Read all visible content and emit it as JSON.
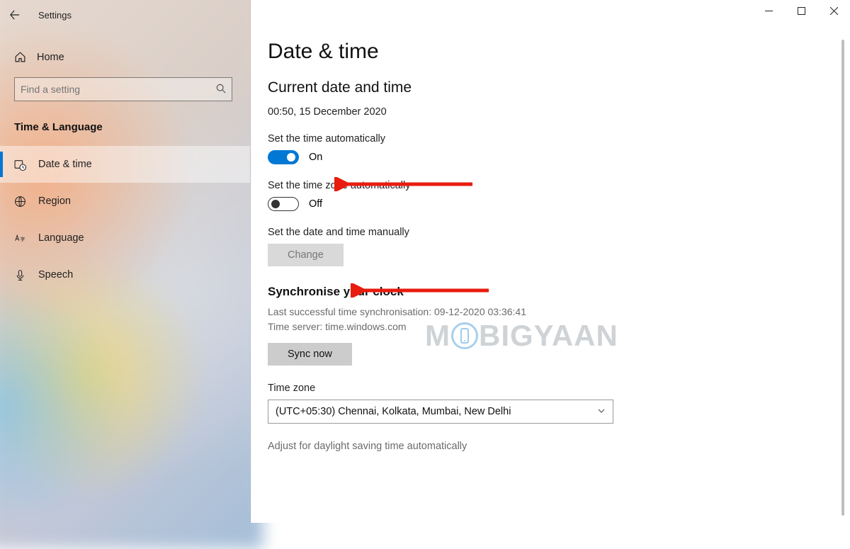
{
  "app": {
    "title": "Settings"
  },
  "sidebar": {
    "home_label": "Home",
    "search_placeholder": "Find a setting",
    "category_title": "Time & Language",
    "items": [
      {
        "label": "Date & time"
      },
      {
        "label": "Region"
      },
      {
        "label": "Language"
      },
      {
        "label": "Speech"
      }
    ]
  },
  "page": {
    "title": "Date & time",
    "current_heading": "Current date and time",
    "current_value": "00:50, 15 December 2020",
    "auto_time_label": "Set the time automatically",
    "auto_time_state": "On",
    "auto_zone_label": "Set the time zone automatically",
    "auto_zone_state": "Off",
    "manual_label": "Set the date and time manually",
    "change_button": "Change",
    "sync_heading": "Synchronise your clock",
    "sync_last": "Last successful time synchronisation: 09-12-2020 03:36:41",
    "sync_server": "Time server: time.windows.com",
    "sync_button": "Sync now",
    "tz_label": "Time zone",
    "tz_value": "(UTC+05:30) Chennai, Kolkata, Mumbai, New Delhi",
    "dst_label": "Adjust for daylight saving time automatically"
  },
  "watermark": {
    "left": "M",
    "right": "BIGYAAN"
  }
}
